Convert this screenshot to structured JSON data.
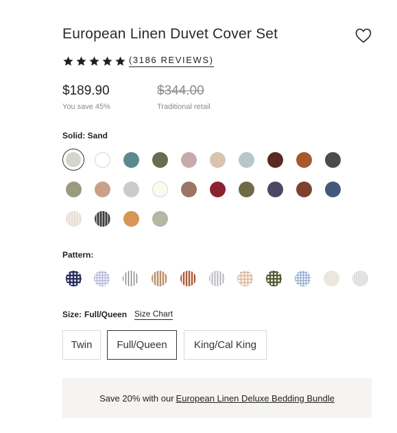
{
  "product": {
    "title": "European Linen Duvet Cover Set",
    "rating_stars": 5,
    "reviews_label": "(3186 REVIEWS)"
  },
  "pricing": {
    "current": "$189.90",
    "savings": "You save 45%",
    "original": "$344.00",
    "original_note": "Traditional retail"
  },
  "solid": {
    "label": "Solid:",
    "selected": "Sand",
    "swatches": [
      {
        "name": "sand",
        "color": "#d7d4cb",
        "selected": true
      },
      {
        "name": "white",
        "color": "#ffffff",
        "outline": true
      },
      {
        "name": "teal",
        "color": "#5b8a8c"
      },
      {
        "name": "olive",
        "color": "#6b6b50"
      },
      {
        "name": "mauve",
        "color": "#c9aaac"
      },
      {
        "name": "blush",
        "color": "#d9c4b1"
      },
      {
        "name": "mist-blue",
        "color": "#b7c7cb"
      },
      {
        "name": "chocolate",
        "color": "#5a2a20"
      },
      {
        "name": "rust",
        "color": "#a8582b"
      },
      {
        "name": "charcoal",
        "color": "#4a4b4c"
      },
      {
        "name": "sage",
        "color": "#9a9a7f"
      },
      {
        "name": "terracotta-light",
        "color": "#c9a188"
      },
      {
        "name": "light-grey",
        "color": "#cbcbcb"
      },
      {
        "name": "ivory",
        "color": "#fcfaee",
        "outline": true
      },
      {
        "name": "clay",
        "color": "#9a7663"
      },
      {
        "name": "crimson",
        "color": "#8a2330"
      },
      {
        "name": "moss",
        "color": "#6f6b45"
      },
      {
        "name": "navy-plum",
        "color": "#4a4863"
      },
      {
        "name": "sienna",
        "color": "#7e4030"
      },
      {
        "name": "denim",
        "color": "#43597a"
      },
      {
        "name": "oat",
        "color": "#e8ddd1"
      },
      {
        "name": "grey-stripe",
        "color": "#5d5d5d"
      },
      {
        "name": "apricot",
        "color": "#d99555"
      },
      {
        "name": "eucalyptus",
        "color": "#b4b7a4"
      }
    ]
  },
  "pattern": {
    "label": "Pattern:",
    "swatches": [
      {
        "name": "navy-gingham",
        "color": "#27295a"
      },
      {
        "name": "lavender-check",
        "color": "#b8b9d8"
      },
      {
        "name": "grey-stripe",
        "color": "#9a9a9a"
      },
      {
        "name": "tan-stripe",
        "color": "#c9a98a"
      },
      {
        "name": "rust-stripe",
        "color": "#b66a48"
      },
      {
        "name": "silver-stripe",
        "color": "#b9b9bd"
      },
      {
        "name": "blush-check",
        "color": "#ddc2ab"
      },
      {
        "name": "green-check",
        "color": "#6c7650"
      },
      {
        "name": "sky-check",
        "color": "#a8bfd6"
      },
      {
        "name": "linen-plain",
        "color": "#ece6dc"
      },
      {
        "name": "pale-grey-stripe",
        "color": "#d8d8da"
      }
    ]
  },
  "size": {
    "label": "Size:",
    "selected": "Full/Queen",
    "chart_link": "Size Chart",
    "options": [
      "Twin",
      "Full/Queen",
      "King/Cal King"
    ]
  },
  "bundle": {
    "text": "Save 20% with our",
    "link": "European Linen Deluxe Bedding Bundle"
  }
}
